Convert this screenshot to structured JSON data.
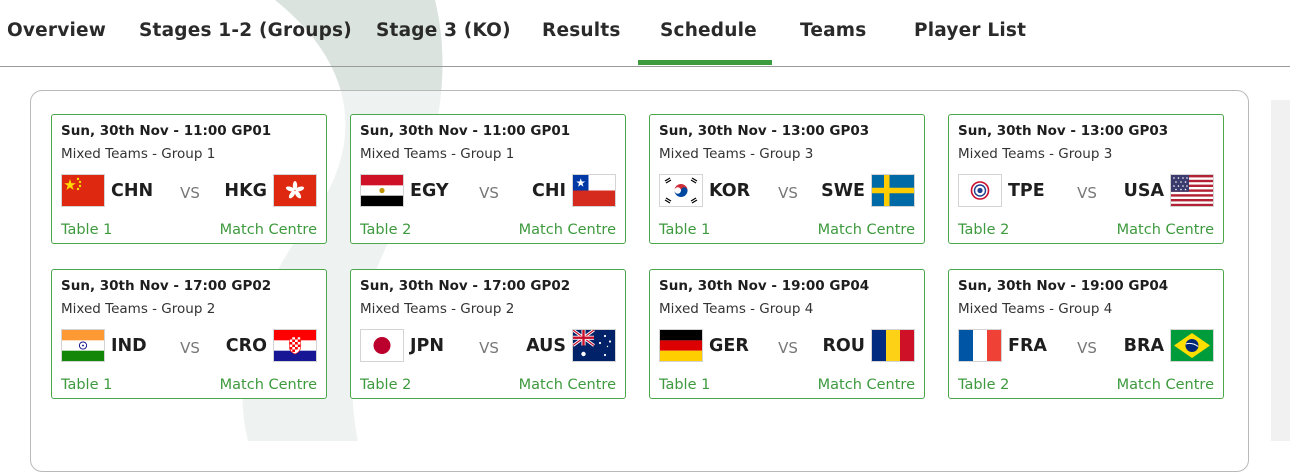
{
  "nav": {
    "tabs": [
      {
        "label": "Overview"
      },
      {
        "label": "Stages 1-2 (Groups)"
      },
      {
        "label": "Stage 3 (KO)"
      },
      {
        "label": "Results"
      },
      {
        "label": "Schedule"
      },
      {
        "label": "Teams"
      },
      {
        "label": "Player List"
      }
    ],
    "active_tab": "Schedule",
    "accent_color": "#3c9b3c"
  },
  "matches": [
    {
      "datetime": "Sun, 30th Nov - 11:00 GP01",
      "group": "Mixed Teams  - Group 1",
      "home": "CHN",
      "away": "HKG",
      "home_flag": "china-flag-icon",
      "away_flag": "hong-kong-flag-icon",
      "vs": "VS",
      "table": "Table 1",
      "match_centre": "Match Centre"
    },
    {
      "datetime": "Sun, 30th Nov - 11:00 GP01",
      "group": "Mixed Teams  - Group 1",
      "home": "EGY",
      "away": "CHI",
      "home_flag": "egypt-flag-icon",
      "away_flag": "chile-flag-icon",
      "vs": "VS",
      "table": "Table 2",
      "match_centre": "Match Centre"
    },
    {
      "datetime": "Sun, 30th Nov - 13:00 GP03",
      "group": "Mixed Teams  - Group 3",
      "home": "KOR",
      "away": "SWE",
      "home_flag": "korea-flag-icon",
      "away_flag": "sweden-flag-icon",
      "vs": "VS",
      "table": "Table 1",
      "match_centre": "Match Centre"
    },
    {
      "datetime": "Sun, 30th Nov - 13:00 GP03",
      "group": "Mixed Teams  - Group 3",
      "home": "TPE",
      "away": "USA",
      "home_flag": "chinese-taipei-flag-icon",
      "away_flag": "usa-flag-icon",
      "vs": "VS",
      "table": "Table 2",
      "match_centre": "Match Centre"
    },
    {
      "datetime": "Sun, 30th Nov - 17:00 GP02",
      "group": "Mixed Teams  - Group 2",
      "home": "IND",
      "away": "CRO",
      "home_flag": "india-flag-icon",
      "away_flag": "croatia-flag-icon",
      "vs": "VS",
      "table": "Table 1",
      "match_centre": "Match Centre"
    },
    {
      "datetime": "Sun, 30th Nov - 17:00 GP02",
      "group": "Mixed Teams  - Group 2",
      "home": "JPN",
      "away": "AUS",
      "home_flag": "japan-flag-icon",
      "away_flag": "australia-flag-icon",
      "vs": "VS",
      "table": "Table 2",
      "match_centre": "Match Centre"
    },
    {
      "datetime": "Sun, 30th Nov - 19:00 GP04",
      "group": "Mixed Teams  - Group 4",
      "home": "GER",
      "away": "ROU",
      "home_flag": "germany-flag-icon",
      "away_flag": "romania-flag-icon",
      "vs": "VS",
      "table": "Table 1",
      "match_centre": "Match Centre"
    },
    {
      "datetime": "Sun, 30th Nov - 19:00 GP04",
      "group": "Mixed Teams  - Group 4",
      "home": "FRA",
      "away": "BRA",
      "home_flag": "france-flag-icon",
      "away_flag": "brazil-flag-icon",
      "vs": "VS",
      "table": "Table 2",
      "match_centre": "Match Centre"
    }
  ]
}
